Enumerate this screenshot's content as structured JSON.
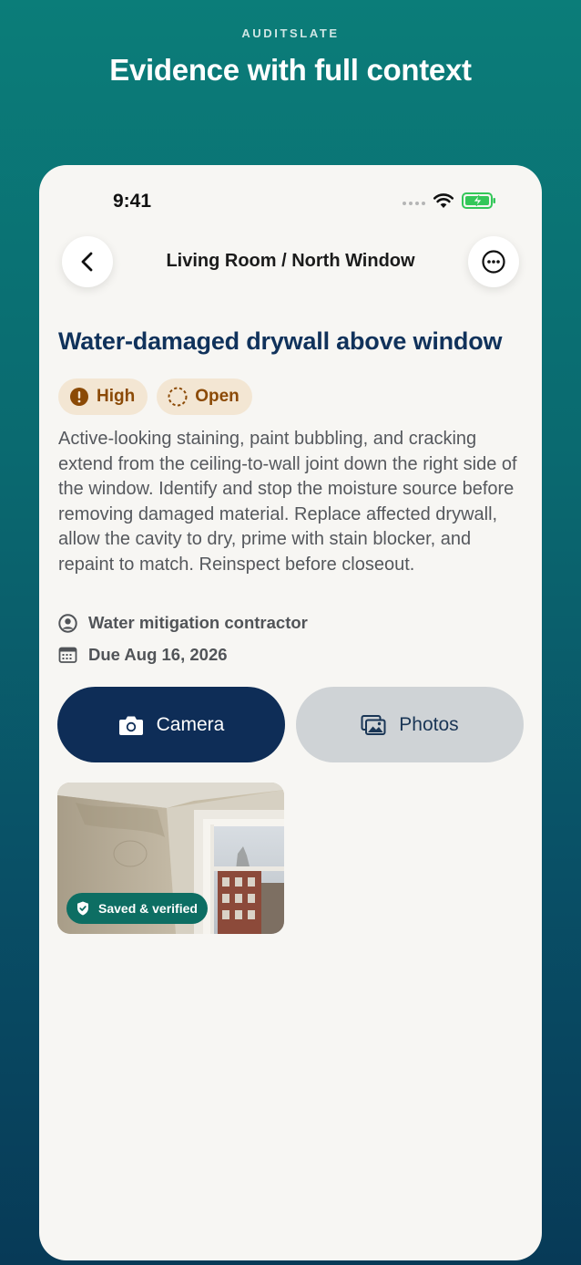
{
  "brand": "AUDITSLATE",
  "headline": "Evidence with full context",
  "status_bar": {
    "time": "9:41"
  },
  "nav": {
    "title": "Living Room / North Window"
  },
  "issue": {
    "title": "Water-damaged drywall above window",
    "severity": "High",
    "status": "Open",
    "description": "Active-looking staining, paint bubbling, and cracking extend from the ceiling-to-wall joint down the right side of the window. Identify and stop the moisture source before removing damaged material. Replace affected drywall, allow the cavity to dry, prime with stain blocker, and repaint to match. Reinspect before closeout.",
    "assignee": "Water mitigation contractor",
    "due": "Due Aug 16, 2026"
  },
  "actions": {
    "camera_label": "Camera",
    "photos_label": "Photos"
  },
  "evidence": [
    {
      "badge": "Saved & verified"
    }
  ],
  "colors": {
    "accent": "#0e2d57",
    "title": "#10325b",
    "chip_bg": "#f3e6d3",
    "chip_text": "#8b4a06",
    "verified": "#0d6e63",
    "battery": "#34c759"
  }
}
